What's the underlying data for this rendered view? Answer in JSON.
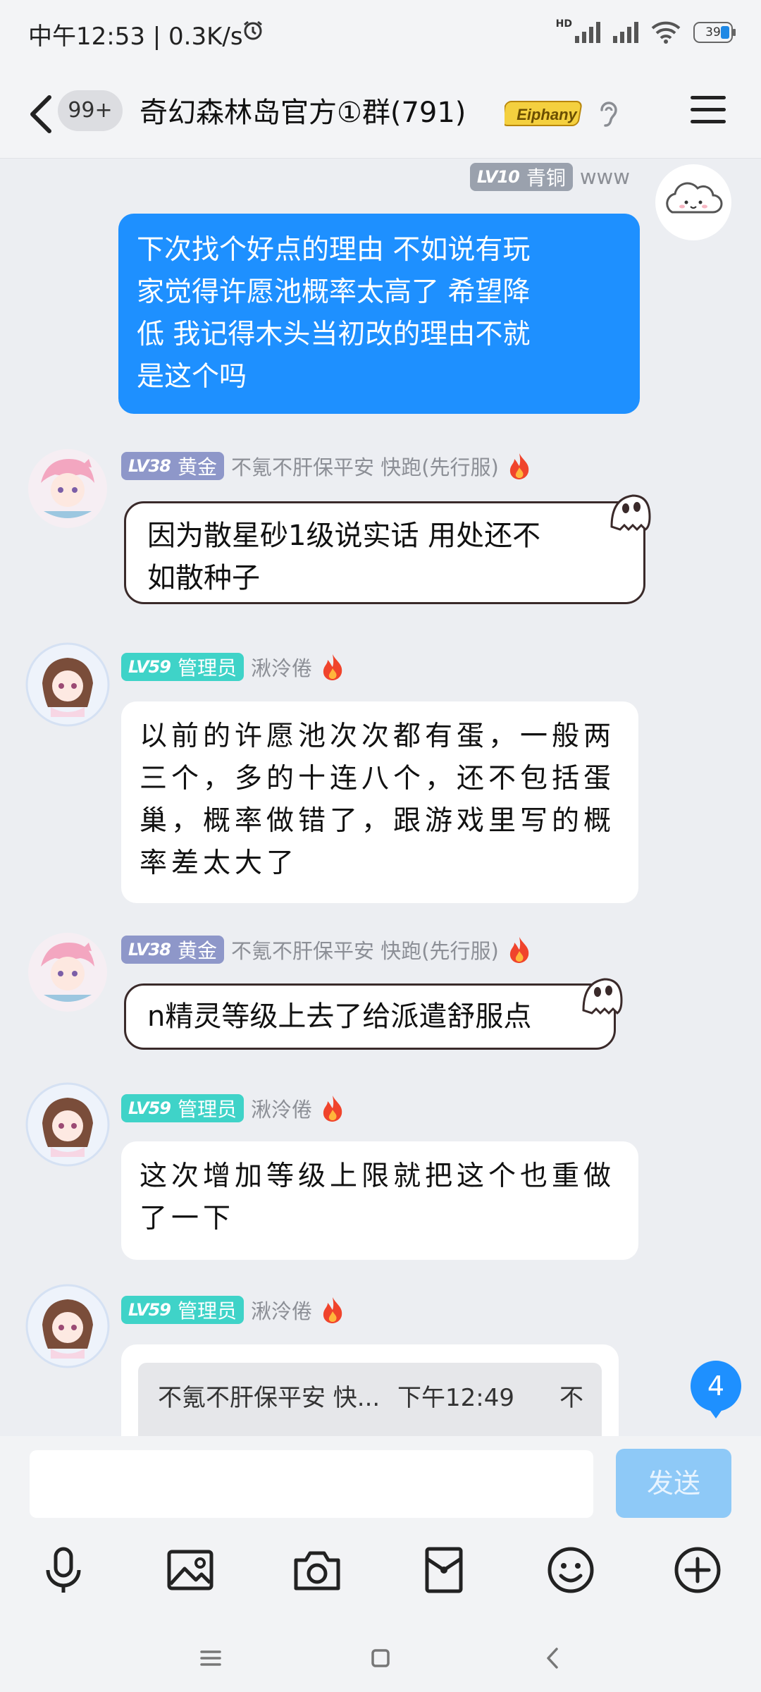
{
  "status_bar": {
    "time": "中午12:53 | 0.3K/s",
    "network_tag": "HD",
    "battery": "39"
  },
  "header": {
    "unread_count": "99+",
    "title": "奇幻森林岛官方①群(791)",
    "badge_text": "Eiphany"
  },
  "messages": [
    {
      "sender": "www",
      "level": "LV10",
      "role": "青铜",
      "text": "下次找个好点的理由 不如说有玩家觉得许愿池概率太高了 希望降低 我记得木头当初改的理由不就是这个吗",
      "lines": [
        "下次找个好点的理由 不如说有玩",
        "家觉得许愿池概率太高了 希望降",
        "低 我记得木头当初改的理由不就",
        "是这个吗"
      ]
    },
    {
      "sender": "不氪不肝保平安 快跑(先行服)",
      "level": "LV38",
      "role": "黄金",
      "lines": [
        "因为散星砂1级说实话 用处还不",
        "如散种子"
      ]
    },
    {
      "sender": "湫泠倦",
      "level": "LV59",
      "role": "管理员",
      "lines": [
        "以前的许愿池次次都有蛋，一般两",
        "三个，多的十连八个，还不包括蛋",
        "巢，概率做错了，跟游戏里写的概",
        "率差太大了"
      ]
    },
    {
      "sender": "不氪不肝保平安 快跑(先行服)",
      "level": "LV38",
      "role": "黄金",
      "lines": [
        "n精灵等级上去了给派遣舒服点"
      ]
    },
    {
      "sender": "湫泠倦",
      "level": "LV59",
      "role": "管理员",
      "lines": [
        "这次增加等级上限就把这个也重做",
        "了一下"
      ]
    },
    {
      "sender": "湫泠倦",
      "level": "LV59",
      "role": "管理员",
      "quote": {
        "name": "不氪不肝保平安 快...",
        "time": "下午12:49",
        "more": "不"
      }
    }
  ],
  "unread_badge": "4",
  "composer": {
    "placeholder": "",
    "send_label": "发送"
  },
  "icons": [
    "voice-icon",
    "image-icon",
    "camera-icon",
    "red-packet-icon",
    "emoji-icon",
    "plus-icon"
  ],
  "colors": {
    "self_bubble": "#1e90ff",
    "admin_tag": "#3fd3c8",
    "gold_tag": "#8e97c9",
    "bronze_tag": "#9aa1ad",
    "send_disabled": "#8ec9f7"
  }
}
